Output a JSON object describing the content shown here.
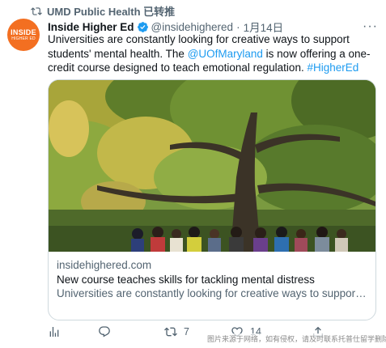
{
  "retweet": {
    "label": "UMD Public Health 已转推"
  },
  "avatar": {
    "line1": "INSIDE",
    "line2": "HIGHER ED"
  },
  "tweet": {
    "author_name": "Inside Higher Ed",
    "handle": "@insidehighered",
    "separator": "·",
    "date": "1月14日",
    "more": "···",
    "text_1": "Universities are constantly looking for creative ways to support students' mental health. The ",
    "mention": "@UOfMaryland",
    "text_2": " is now offering a one-credit course designed to teach emotional regulation. ",
    "hashtag": "#HigherEd"
  },
  "card": {
    "domain": "insidehighered.com",
    "title": "New course teaches skills for tackling mental distress",
    "description": "Universities are constantly looking for creative ways to support students' mental health. The University of Maryland is now offering a ..."
  },
  "actions": {
    "views": "",
    "replies": "",
    "retweets": "7",
    "likes": "14"
  },
  "watermark": "图片来源于网络，如有侵权，请及时联系托普仕留学删除",
  "colors": {
    "accent": "#1d9bf0",
    "muted": "#536471",
    "brand_orange": "#f36f21"
  }
}
